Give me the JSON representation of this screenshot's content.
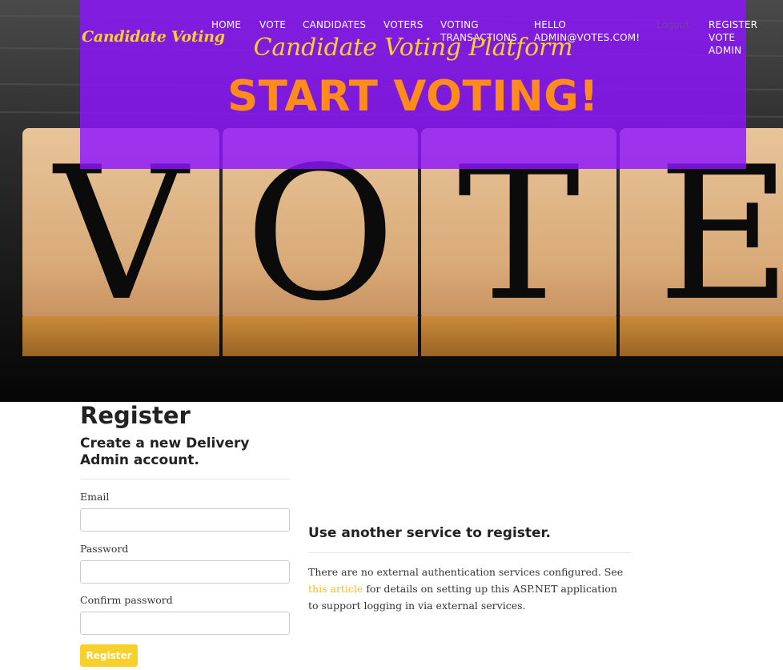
{
  "brand": "Candidate Voting",
  "nav": {
    "home": "HOME",
    "vote": "VOTE",
    "candidates": "CANDIDATES",
    "voters": "VOTERS",
    "voting_transactions_l1": "VOTING",
    "voting_transactions_l2": "TRANSACTIONS",
    "hello_l1": "HELLO",
    "hello_l2": "ADMIN@VOTES.COM!",
    "logout": "Logout",
    "register_l1": "REGISTER",
    "register_l2": "VOTE",
    "register_l3": "ADMIN"
  },
  "hero": {
    "platform_title": "Candidate Voting Platform",
    "cta": "START VOTING!",
    "blocks": [
      "V",
      "O",
      "T",
      "E"
    ]
  },
  "register": {
    "title": "Register",
    "subtitle": "Create a new Delivery Admin account.",
    "email_label": "Email",
    "email_value": "",
    "password_label": "Password",
    "password_value": "",
    "confirm_label": "Confirm password",
    "confirm_value": "",
    "submit_label": "Register"
  },
  "external": {
    "title": "Use another service to register.",
    "text_before": "There are no external authentication services configured. See ",
    "link_text": "this article",
    "text_after": " for details on setting up this ASP.NET application to support logging in via external services."
  },
  "colors": {
    "overlay": "#8c14ff",
    "brand_yellow": "#f7d02a",
    "cta_orange": "#ff8c1a",
    "button_yellow": "#f7d02a"
  }
}
